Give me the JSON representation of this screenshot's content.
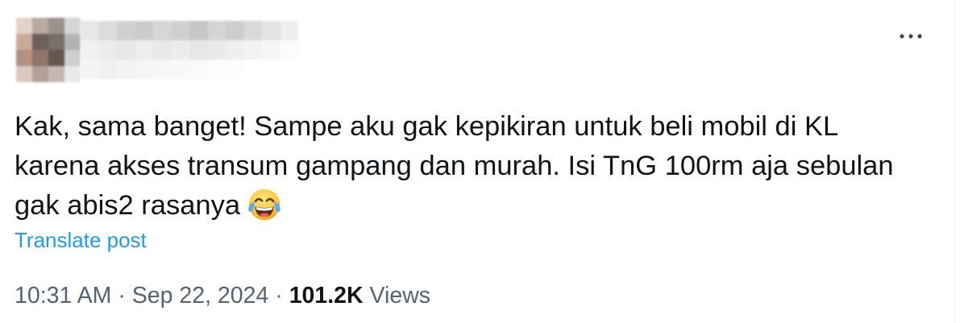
{
  "post": {
    "more_icon": "more-options-icon",
    "text_lines": [
      "Kak, sama banget! Sampe aku gak kepikiran untuk beli mobil di KL",
      "karena akses transum gampang dan murah. Isi TnG 100rm aja sebulan",
      "gak abis2 rasanya"
    ],
    "emoji_icon": "face-with-tears-of-joy-icon",
    "translate_label": "Translate post",
    "time": "10:31 AM",
    "separator": "·",
    "date": "Sep 22, 2024",
    "views_count": "101.2K",
    "views_label": "Views"
  },
  "colors": {
    "text": "#0f1419",
    "muted": "#536471",
    "link": "#1d9bf0"
  }
}
